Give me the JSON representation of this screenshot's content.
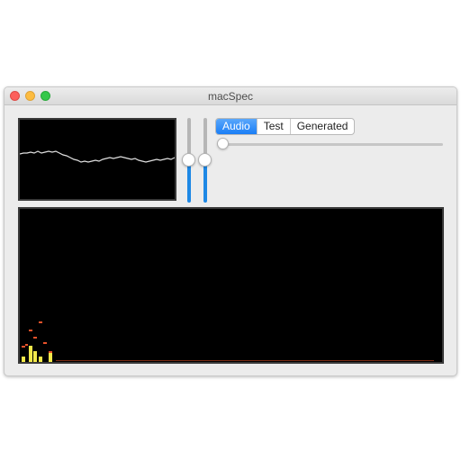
{
  "window": {
    "title": "macSpec",
    "controls": [
      "close",
      "minimize",
      "zoom"
    ]
  },
  "source_selector": {
    "options": [
      "Audio",
      "Test",
      "Generated"
    ],
    "selected": "Audio"
  },
  "sliders": {
    "vertical_1_level": 0.5,
    "vertical_2_level": 0.5,
    "horizontal_level": 0.0
  },
  "colors": {
    "accent": "#1e88e5",
    "segment_selected": "#2a86f7",
    "display_background": "#000000",
    "waveform_line": "#e0e0e0",
    "spectrum_bar": "#f2e84a",
    "spectrum_peak": "#e8522a"
  },
  "icons": {
    "close": "close-icon",
    "minimize": "minimize-icon",
    "zoom": "zoom-icon"
  }
}
